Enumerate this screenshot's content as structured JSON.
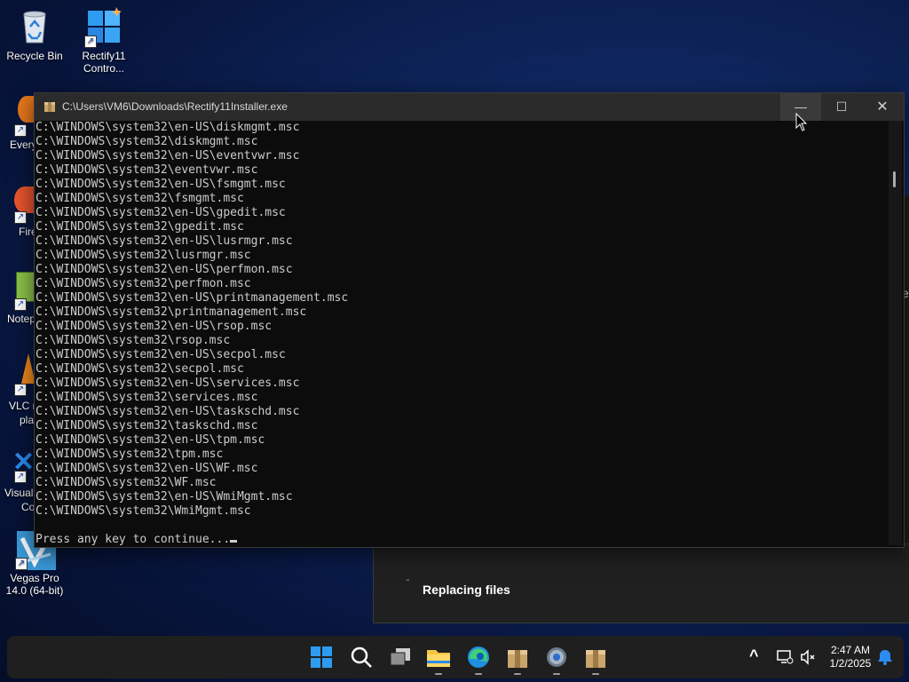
{
  "desktop": {
    "icons": [
      {
        "label": "Recycle Bin",
        "icon": "recycle-bin-icon"
      },
      {
        "label": "Rectify11 Contro...",
        "icon": "control-panel-icon"
      },
      {
        "label": "Vegas Pro 14.0 (64-bit)",
        "icon": "vegas-pro-icon"
      }
    ],
    "partial_labels": [
      "Every",
      "Fire",
      "Notep",
      "VLC m",
      "pla",
      "Visual",
      "Co"
    ]
  },
  "console": {
    "title": "C:\\Users\\VM6\\Downloads\\Rectify11Installer.exe",
    "lines": [
      "C:\\WINDOWS\\system32\\en-US\\diskmgmt.msc",
      "C:\\WINDOWS\\system32\\diskmgmt.msc",
      "C:\\WINDOWS\\system32\\en-US\\eventvwr.msc",
      "C:\\WINDOWS\\system32\\eventvwr.msc",
      "C:\\WINDOWS\\system32\\en-US\\fsmgmt.msc",
      "C:\\WINDOWS\\system32\\fsmgmt.msc",
      "C:\\WINDOWS\\system32\\en-US\\gpedit.msc",
      "C:\\WINDOWS\\system32\\gpedit.msc",
      "C:\\WINDOWS\\system32\\en-US\\lusrmgr.msc",
      "C:\\WINDOWS\\system32\\lusrmgr.msc",
      "C:\\WINDOWS\\system32\\en-US\\perfmon.msc",
      "C:\\WINDOWS\\system32\\perfmon.msc",
      "C:\\WINDOWS\\system32\\en-US\\printmanagement.msc",
      "C:\\WINDOWS\\system32\\printmanagement.msc",
      "C:\\WINDOWS\\system32\\en-US\\rsop.msc",
      "C:\\WINDOWS\\system32\\rsop.msc",
      "C:\\WINDOWS\\system32\\en-US\\secpol.msc",
      "C:\\WINDOWS\\system32\\secpol.msc",
      "C:\\WINDOWS\\system32\\en-US\\services.msc",
      "C:\\WINDOWS\\system32\\services.msc",
      "C:\\WINDOWS\\system32\\en-US\\taskschd.msc",
      "C:\\WINDOWS\\system32\\taskschd.msc",
      "C:\\WINDOWS\\system32\\en-US\\tpm.msc",
      "C:\\WINDOWS\\system32\\tpm.msc",
      "C:\\WINDOWS\\system32\\en-US\\WF.msc",
      "C:\\WINDOWS\\system32\\WF.msc",
      "C:\\WINDOWS\\system32\\en-US\\WmiMgmt.msc",
      "C:\\WINDOWS\\system32\\WmiMgmt.msc",
      ""
    ],
    "prompt": "Press any key to continue...",
    "buttons": {
      "minimize": "—",
      "maximize": "☐",
      "close": "✕"
    }
  },
  "setup_window": {
    "status": "Replacing files",
    "spinner": "˘"
  },
  "background_edge": {
    "glyph": "e"
  },
  "taskbar": {
    "apps": [
      "start-icon",
      "search-icon",
      "task-view-icon",
      "file-explorer-icon",
      "edge-icon",
      "installer-icon",
      "settings-icon",
      "installer-icon-2"
    ],
    "tray_chevron": "^",
    "clock": {
      "time": "2:47 AM",
      "date": "1/2/2025"
    }
  },
  "colors": {
    "console_bg": "#0c0c0c",
    "console_text": "#cccccc",
    "titlebar": "#2b2b2b",
    "taskbar": "#1f1f1f"
  }
}
